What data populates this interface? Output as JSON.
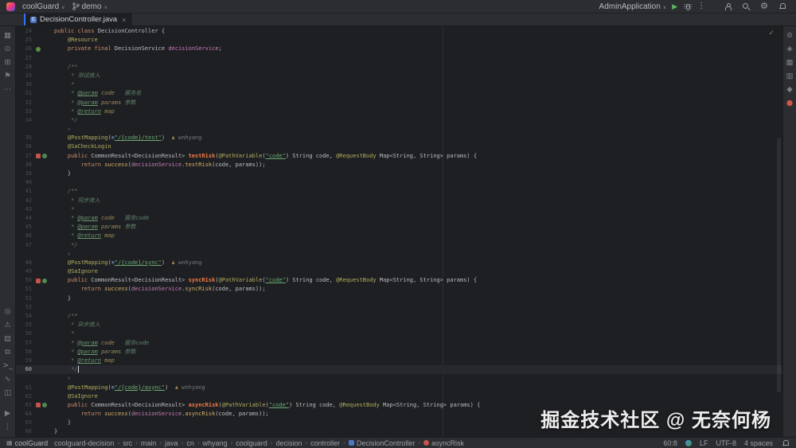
{
  "colors": {
    "accent": "#3574f0",
    "editor_bg": "#1e1f22",
    "chrome_bg": "#2b2d30",
    "run_green": "#5fb865",
    "ok_green": "#5c9c60",
    "keyword": "#cf8e6d",
    "string": "#6aab73",
    "annotation": "#b3ae60",
    "field": "#c77dbb",
    "doc_comment": "#5f826b",
    "method_decl": "#ef7b48"
  },
  "topbar": {
    "project": "coolGuard",
    "branch": "demo",
    "run_config": "AdminApplication",
    "chevron": "∨",
    "play": "▶",
    "more": "⋮"
  },
  "tab": {
    "label": "DecisionController.java",
    "close": "×",
    "class_letter": "C"
  },
  "left_strip": {
    "top": [
      {
        "name": "project-icon",
        "glyph": "▦"
      },
      {
        "name": "commit-icon",
        "glyph": "⊙"
      },
      {
        "name": "structure-icon",
        "glyph": "⊞"
      },
      {
        "name": "bookmarks-icon",
        "glyph": "⚑"
      },
      {
        "name": "more-tools-icon",
        "glyph": "⋯"
      }
    ],
    "bottom": [
      {
        "name": "search-tool-icon",
        "glyph": "◎"
      },
      {
        "name": "problems-icon",
        "glyph": "⚠"
      },
      {
        "name": "todo-icon",
        "glyph": "▤"
      },
      {
        "name": "services-icon",
        "glyph": "⧉"
      },
      {
        "name": "terminal-icon",
        "glyph": ">_"
      },
      {
        "name": "endpoints-icon",
        "glyph": "∿"
      },
      {
        "name": "build-icon",
        "glyph": "◫"
      }
    ],
    "footer": [
      {
        "name": "run-tool-icon",
        "glyph": "▶"
      },
      {
        "name": "more-bottom-icon",
        "glyph": "⋮"
      }
    ]
  },
  "right_strip": {
    "icons": [
      {
        "name": "notifications-icon",
        "glyph": "⊚"
      },
      {
        "name": "gradle-icon",
        "glyph": "◈"
      },
      {
        "name": "maven-icon",
        "glyph": "▦"
      },
      {
        "name": "database-icon",
        "glyph": "▥"
      },
      {
        "name": "ai-assistant-icon",
        "glyph": "◆"
      },
      {
        "name": "plugin-icon",
        "glyph": "●",
        "color": "#d35450"
      }
    ]
  },
  "editor": {
    "inspection_ok": "✓",
    "watermark": "掘金技术社区 @ 无奈何杨",
    "current_line": 60,
    "rows": [
      {
        "n": 24,
        "t": [
          [
            "kw",
            "public"
          ],
          [
            "d",
            " "
          ],
          [
            "kw",
            "class"
          ],
          [
            "d",
            " "
          ],
          [
            "d",
            "DecisionController {"
          ]
        ]
      },
      {
        "n": 25,
        "t": [
          [
            "d",
            "    "
          ],
          [
            "ann",
            "@Resource"
          ]
        ]
      },
      {
        "n": 26,
        "icons": [
          "bean"
        ],
        "t": [
          [
            "d",
            "    "
          ],
          [
            "kw",
            "private"
          ],
          [
            "d",
            " "
          ],
          [
            "kw",
            "final"
          ],
          [
            "d",
            " DecisionService "
          ],
          [
            "fld",
            "decisionService"
          ],
          [
            "d",
            ";"
          ]
        ]
      },
      {
        "n": 27,
        "t": []
      },
      {
        "n": 28,
        "t": [
          [
            "d",
            "    "
          ],
          [
            "doc",
            "/**"
          ]
        ]
      },
      {
        "n": 29,
        "t": [
          [
            "d",
            "     "
          ],
          [
            "doc",
            "* 测试接入"
          ]
        ]
      },
      {
        "n": 30,
        "t": [
          [
            "d",
            "     "
          ],
          [
            "doc",
            "*"
          ]
        ]
      },
      {
        "n": 31,
        "t": [
          [
            "d",
            "     "
          ],
          [
            "doc",
            "* "
          ],
          [
            "dtag",
            "@param"
          ],
          [
            "doc",
            " "
          ],
          [
            "dval",
            "code"
          ],
          [
            "doc",
            "   服务名"
          ]
        ]
      },
      {
        "n": 32,
        "t": [
          [
            "d",
            "     "
          ],
          [
            "doc",
            "* "
          ],
          [
            "dtag",
            "@param"
          ],
          [
            "doc",
            " "
          ],
          [
            "dval",
            "params"
          ],
          [
            "doc",
            " 参数"
          ]
        ]
      },
      {
        "n": 33,
        "t": [
          [
            "d",
            "     "
          ],
          [
            "doc",
            "* "
          ],
          [
            "dtag",
            "@return"
          ],
          [
            "doc",
            " "
          ],
          [
            "dval",
            "map"
          ]
        ]
      },
      {
        "n": 34,
        "t": [
          [
            "d",
            "     "
          ],
          [
            "doc",
            "*/"
          ]
        ]
      },
      {
        "t": [
          [
            "d",
            "    "
          ],
          [
            "inlay",
            "∨"
          ]
        ]
      },
      {
        "n": 35,
        "t": [
          [
            "d",
            "    "
          ],
          [
            "ann",
            "@PostMapping"
          ],
          [
            "d",
            "("
          ],
          [
            "uicon",
            "⊕"
          ],
          [
            "str",
            "\"/{code}/test\""
          ],
          [
            "d",
            ")"
          ],
          [
            "d",
            "  "
          ],
          [
            "aicon",
            "♟"
          ],
          [
            "author",
            " wnhyang"
          ]
        ]
      },
      {
        "n": 36,
        "t": [
          [
            "d",
            "    "
          ],
          [
            "ann",
            "@SaCheckLogin"
          ]
        ]
      },
      {
        "n": 37,
        "icons": [
          "api",
          "map"
        ],
        "t": [
          [
            "d",
            "    "
          ],
          [
            "kw",
            "public"
          ],
          [
            "d",
            " CommonResult<DecisionResult> "
          ],
          [
            "m",
            "testRisk"
          ],
          [
            "d",
            "("
          ],
          [
            "ann",
            "@PathVariable"
          ],
          [
            "d",
            "("
          ],
          [
            "str",
            "\"code\""
          ],
          [
            "d",
            ") String code, "
          ],
          [
            "ann",
            "@RequestBody"
          ],
          [
            "d",
            " Map<String, String> params) {"
          ]
        ]
      },
      {
        "n": 38,
        "t": [
          [
            "d",
            "        "
          ],
          [
            "kw",
            "return"
          ],
          [
            "d",
            " "
          ],
          [
            "calli",
            "success"
          ],
          [
            "d",
            "("
          ],
          [
            "fld",
            "decisionService"
          ],
          [
            "d",
            "."
          ],
          [
            "call",
            "testRisk"
          ],
          [
            "d",
            "(code, params));"
          ]
        ]
      },
      {
        "n": 39,
        "t": [
          [
            "d",
            "    }"
          ]
        ]
      },
      {
        "n": 40,
        "t": []
      },
      {
        "n": 41,
        "t": [
          [
            "d",
            "    "
          ],
          [
            "doc",
            "/**"
          ]
        ]
      },
      {
        "n": 42,
        "t": [
          [
            "d",
            "     "
          ],
          [
            "doc",
            "* 同步接入"
          ]
        ]
      },
      {
        "n": 43,
        "t": [
          [
            "d",
            "     "
          ],
          [
            "doc",
            "*"
          ]
        ]
      },
      {
        "n": 44,
        "t": [
          [
            "d",
            "     "
          ],
          [
            "doc",
            "* "
          ],
          [
            "dtag",
            "@param"
          ],
          [
            "doc",
            " "
          ],
          [
            "dval",
            "code"
          ],
          [
            "doc",
            "   服务code"
          ]
        ]
      },
      {
        "n": 45,
        "t": [
          [
            "d",
            "     "
          ],
          [
            "doc",
            "* "
          ],
          [
            "dtag",
            "@param"
          ],
          [
            "doc",
            " "
          ],
          [
            "dval",
            "params"
          ],
          [
            "doc",
            " 参数"
          ]
        ]
      },
      {
        "n": 46,
        "t": [
          [
            "d",
            "     "
          ],
          [
            "doc",
            "* "
          ],
          [
            "dtag",
            "@return"
          ],
          [
            "doc",
            " "
          ],
          [
            "dval",
            "map"
          ]
        ]
      },
      {
        "n": 47,
        "t": [
          [
            "d",
            "     "
          ],
          [
            "doc",
            "*/"
          ]
        ]
      },
      {
        "t": [
          [
            "d",
            "    "
          ],
          [
            "inlay",
            "∨"
          ]
        ]
      },
      {
        "n": 48,
        "t": [
          [
            "d",
            "    "
          ],
          [
            "ann",
            "@PostMapping"
          ],
          [
            "d",
            "("
          ],
          [
            "uicon",
            "⊕"
          ],
          [
            "str",
            "\"/{code}/sync\""
          ],
          [
            "d",
            ")"
          ],
          [
            "d",
            "  "
          ],
          [
            "aicon",
            "♟"
          ],
          [
            "author",
            " wnhyang"
          ]
        ]
      },
      {
        "n": 49,
        "t": [
          [
            "d",
            "    "
          ],
          [
            "ann",
            "@SaIgnore"
          ]
        ]
      },
      {
        "n": 50,
        "icons": [
          "api",
          "map"
        ],
        "t": [
          [
            "d",
            "    "
          ],
          [
            "kw",
            "public"
          ],
          [
            "d",
            " CommonResult<DecisionResult> "
          ],
          [
            "m",
            "syncRisk"
          ],
          [
            "d",
            "("
          ],
          [
            "ann",
            "@PathVariable"
          ],
          [
            "d",
            "("
          ],
          [
            "str",
            "\"code\""
          ],
          [
            "d",
            ") String code, "
          ],
          [
            "ann",
            "@RequestBody"
          ],
          [
            "d",
            " Map<String, String> params) {"
          ]
        ]
      },
      {
        "n": 51,
        "t": [
          [
            "d",
            "        "
          ],
          [
            "kw",
            "return"
          ],
          [
            "d",
            " "
          ],
          [
            "calli",
            "success"
          ],
          [
            "d",
            "("
          ],
          [
            "fld",
            "decisionService"
          ],
          [
            "d",
            "."
          ],
          [
            "call",
            "syncRisk"
          ],
          [
            "d",
            "(code, params));"
          ]
        ]
      },
      {
        "n": 52,
        "t": [
          [
            "d",
            "    }"
          ]
        ]
      },
      {
        "n": 53,
        "t": []
      },
      {
        "n": 54,
        "t": [
          [
            "d",
            "    "
          ],
          [
            "doc",
            "/**"
          ]
        ]
      },
      {
        "n": 55,
        "t": [
          [
            "d",
            "     "
          ],
          [
            "doc",
            "* 异步接入"
          ]
        ]
      },
      {
        "n": 56,
        "t": [
          [
            "d",
            "     "
          ],
          [
            "doc",
            "*"
          ]
        ]
      },
      {
        "n": 57,
        "t": [
          [
            "d",
            "     "
          ],
          [
            "doc",
            "* "
          ],
          [
            "dtag",
            "@param"
          ],
          [
            "doc",
            " "
          ],
          [
            "dval",
            "code"
          ],
          [
            "doc",
            "   服务code"
          ]
        ]
      },
      {
        "n": 58,
        "t": [
          [
            "d",
            "     "
          ],
          [
            "doc",
            "* "
          ],
          [
            "dtag",
            "@param"
          ],
          [
            "doc",
            " "
          ],
          [
            "dval",
            "params"
          ],
          [
            "doc",
            " 参数"
          ]
        ]
      },
      {
        "n": 59,
        "t": [
          [
            "d",
            "     "
          ],
          [
            "doc",
            "* "
          ],
          [
            "dtag",
            "@return"
          ],
          [
            "doc",
            " "
          ],
          [
            "dval",
            "map"
          ]
        ]
      },
      {
        "n": 60,
        "cur": true,
        "caret": true,
        "t": [
          [
            "d",
            "     "
          ],
          [
            "doc",
            "*/"
          ]
        ]
      },
      {
        "t": [
          [
            "d",
            "    "
          ],
          [
            "inlay",
            "∨"
          ]
        ]
      },
      {
        "n": 61,
        "t": [
          [
            "d",
            "    "
          ],
          [
            "ann",
            "@PostMapping"
          ],
          [
            "d",
            "("
          ],
          [
            "uicon",
            "⊕"
          ],
          [
            "str",
            "\"/{code}/async\""
          ],
          [
            "d",
            ")"
          ],
          [
            "d",
            "  "
          ],
          [
            "aicon",
            "♟"
          ],
          [
            "author",
            " wnhyang"
          ]
        ]
      },
      {
        "n": 62,
        "t": [
          [
            "d",
            "    "
          ],
          [
            "ann",
            "@SaIgnore"
          ]
        ]
      },
      {
        "n": 63,
        "icons": [
          "api",
          "map"
        ],
        "t": [
          [
            "d",
            "    "
          ],
          [
            "kw",
            "public"
          ],
          [
            "d",
            " CommonResult<DecisionResult> "
          ],
          [
            "m",
            "asyncRisk"
          ],
          [
            "d",
            "("
          ],
          [
            "ann",
            "@PathVariable"
          ],
          [
            "d",
            "("
          ],
          [
            "str",
            "\"code\""
          ],
          [
            "d",
            ") String code, "
          ],
          [
            "ann",
            "@RequestBody"
          ],
          [
            "d",
            " Map<String, String> params) {"
          ]
        ]
      },
      {
        "n": 64,
        "t": [
          [
            "d",
            "        "
          ],
          [
            "kw",
            "return"
          ],
          [
            "d",
            " "
          ],
          [
            "calli",
            "success"
          ],
          [
            "d",
            "("
          ],
          [
            "fld",
            "decisionService"
          ],
          [
            "d",
            "."
          ],
          [
            "call",
            "asyncRisk"
          ],
          [
            "d",
            "(code, params));"
          ]
        ]
      },
      {
        "n": 65,
        "t": [
          [
            "d",
            "    }"
          ]
        ]
      },
      {
        "n": 66,
        "t": [
          [
            "d",
            "}"
          ]
        ]
      }
    ]
  },
  "statusbar": {
    "project": "coolGuard",
    "project_icon": "▦",
    "breadcrumbs": [
      {
        "text": "coolguard-decision"
      },
      {
        "text": "src"
      },
      {
        "text": "main"
      },
      {
        "text": "java"
      },
      {
        "text": "cn"
      },
      {
        "text": "whyang"
      },
      {
        "text": "coolguard"
      },
      {
        "text": "decision"
      },
      {
        "text": "controller"
      },
      {
        "text": "DecisionController",
        "icon": "class"
      },
      {
        "text": "asyncRisk",
        "icon": "method"
      }
    ],
    "caret": "60:8",
    "line_ending": "LF",
    "encoding": "UTF-8",
    "indent": "4 spaces"
  }
}
